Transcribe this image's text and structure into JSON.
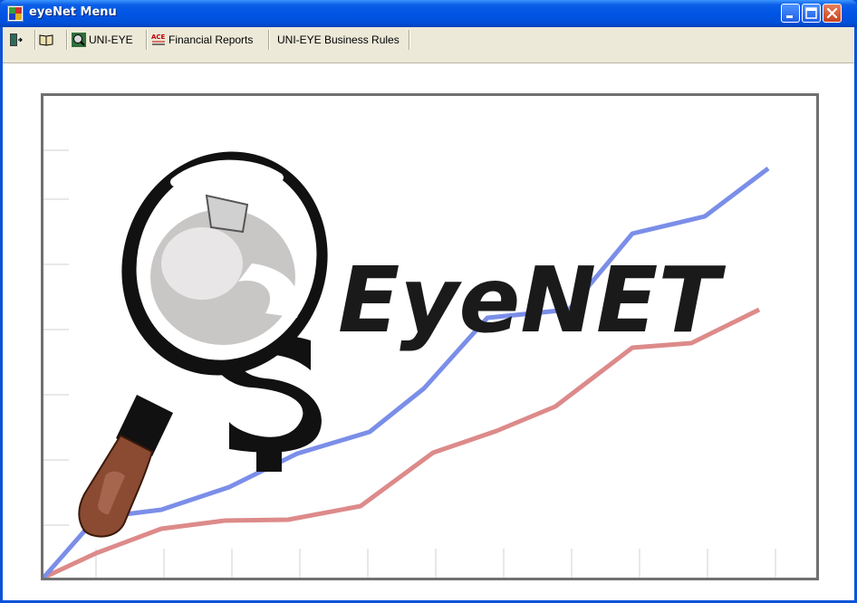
{
  "window": {
    "title": "eyeNet Menu",
    "app_icon": "pos-app-icon",
    "title_bar_color": "#0055e5",
    "controls": [
      "minimize-icon",
      "maximize-icon",
      "close-icon"
    ]
  },
  "menubar": {
    "items": [
      {
        "name": "exit",
        "icon": "door-exit-icon",
        "label": ""
      },
      {
        "name": "help",
        "icon": "open-book-icon",
        "label": ""
      },
      {
        "name": "uni-eye",
        "icon": "magnifier-globe-icon",
        "label": "UNI-EYE"
      },
      {
        "name": "financial-reports",
        "icon": "ace-report-icon",
        "label": "Financial Reports"
      },
      {
        "name": "business-rules",
        "icon": "",
        "label": "UNI-EYE Business Rules"
      }
    ]
  },
  "splash": {
    "logo_text": "EyeNET",
    "logo_color": "#1a1a1a",
    "series_colors": {
      "blue": "#7b8ee8",
      "red": "#dd8a8a"
    },
    "frame_color": "#707070"
  }
}
